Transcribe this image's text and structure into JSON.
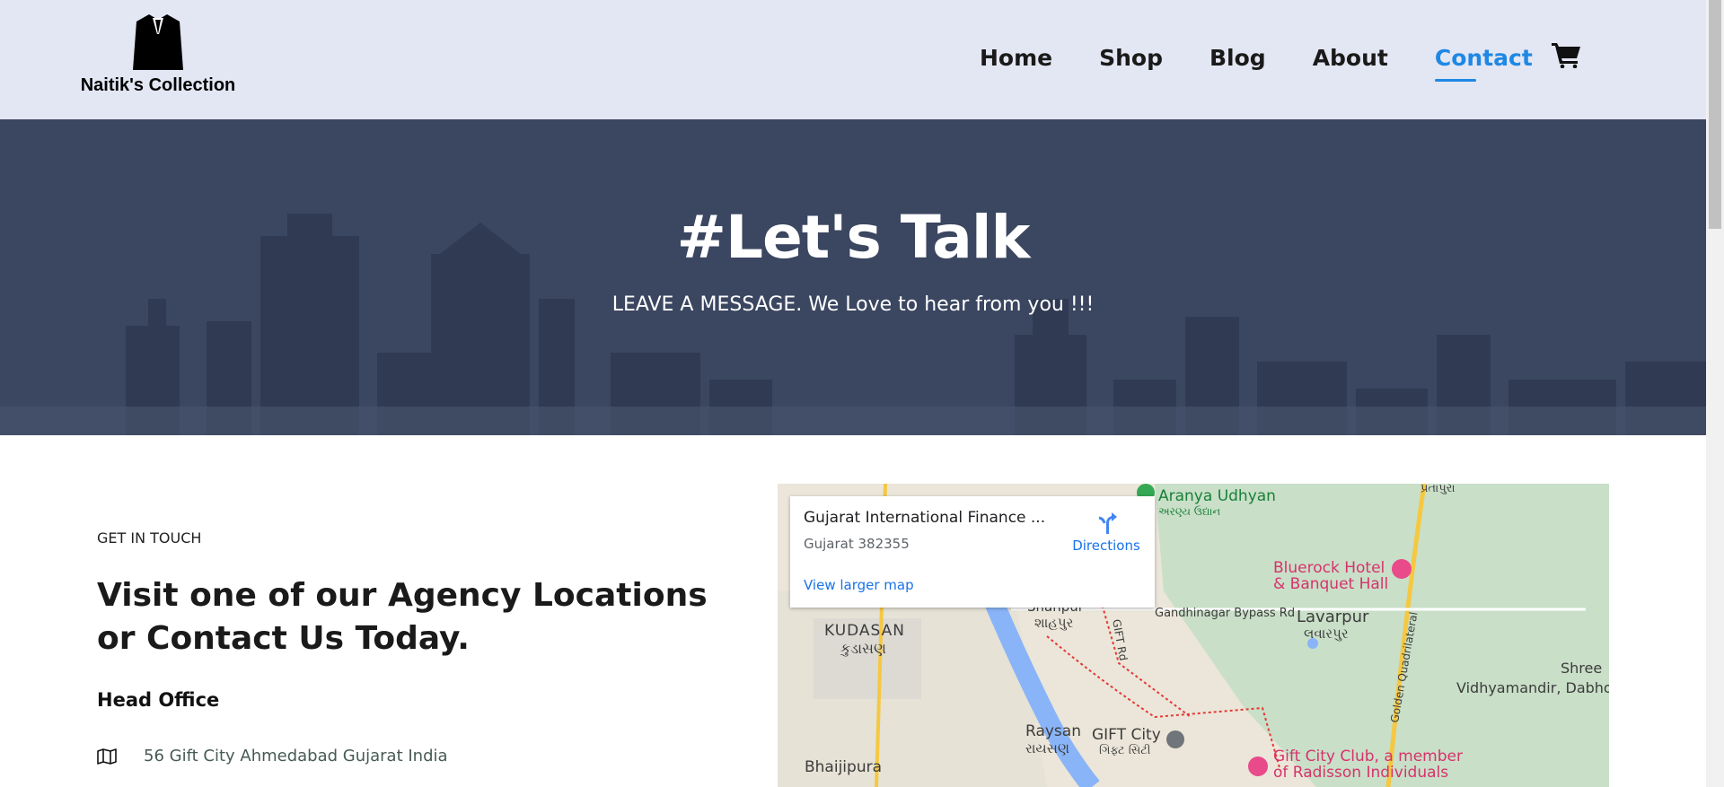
{
  "brand": {
    "name": "Naitik's Collection"
  },
  "nav": {
    "items": [
      {
        "label": "Home"
      },
      {
        "label": "Shop"
      },
      {
        "label": "Blog"
      },
      {
        "label": "About"
      },
      {
        "label": "Contact"
      }
    ],
    "active": "Contact"
  },
  "hero": {
    "title": "#Let's Talk",
    "subtitle": "LEAVE A MESSAGE. We Love to hear from you !!!"
  },
  "contact": {
    "eyebrow": "GET IN TOUCH",
    "heading": "Visit one of our Agency Locations or Contact Us Today.",
    "head_office": "Head Office",
    "address": "56 Gift City Ahmedabad Gujarat India"
  },
  "map": {
    "place_name": "Gujarat International Finance ...",
    "place_sub": "Gujarat 382355",
    "directions_label": "Directions",
    "larger_map_label": "View larger map",
    "labels": [
      {
        "text": "Aranya Udhyan"
      },
      {
        "text": "અરણ્ય ઉદ્યાન"
      },
      {
        "text": "Bluerock Hotel"
      },
      {
        "text": "& Banquet Hall"
      },
      {
        "text": "Gandhinagar Bypass Rd"
      },
      {
        "text": "Lavarpur"
      },
      {
        "text": "લવારપુર"
      },
      {
        "text": "KUDASAN"
      },
      {
        "text": "કુડાસણ"
      },
      {
        "text": "Shahpur"
      },
      {
        "text": "શાહપુર"
      },
      {
        "text": "GIFT Rd"
      },
      {
        "text": "Golden Quadrilateral"
      },
      {
        "text": "Shree"
      },
      {
        "text": "Vidhyamandir, Dabhoda"
      },
      {
        "text": "Raysan"
      },
      {
        "text": "રાયસણ"
      },
      {
        "text": "GIFT City"
      },
      {
        "text": "ગિફ્ટ સિટી"
      },
      {
        "text": "Gift City Club, a member"
      },
      {
        "text": "of Radisson Individuals"
      },
      {
        "text": "Bhaijipura"
      },
      {
        "text": "પ્રતાપુરા"
      }
    ]
  },
  "icons": {
    "cart": "shopping-cart-icon",
    "address": "map-icon",
    "directions": "directions-icon"
  },
  "colors": {
    "header_bg": "#e3e6f3",
    "hero_bg": "#3b4660",
    "accent": "#1e88e5",
    "map_link": "#1a73e8"
  }
}
